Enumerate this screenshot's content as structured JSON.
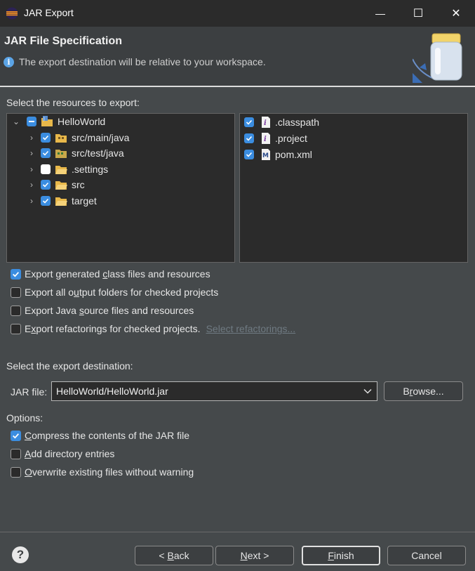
{
  "window": {
    "title": "JAR Export",
    "minimize_glyph": "—",
    "maximize_glyph": "☐",
    "close_glyph": "✕"
  },
  "header": {
    "title": "JAR File Specification",
    "message": "The export destination will be relative to your workspace.",
    "info_glyph": "i"
  },
  "resources": {
    "label": "Select the resources to export:",
    "tree": [
      {
        "label": "HelloWorld",
        "state": "mixed",
        "expanded": true,
        "icon": "project-icon"
      },
      {
        "label": "src/main/java",
        "state": "checked",
        "icon": "package-folder-icon"
      },
      {
        "label": "src/test/java",
        "state": "checked",
        "icon": "package-folder-icon"
      },
      {
        "label": ".settings",
        "state": "unchecked",
        "icon": "folder-icon"
      },
      {
        "label": "src",
        "state": "checked",
        "icon": "folder-icon"
      },
      {
        "label": "target",
        "state": "checked",
        "icon": "folder-icon"
      }
    ],
    "files": [
      {
        "label": ".classpath",
        "state": "checked",
        "icon": "file-icon"
      },
      {
        "label": ".project",
        "state": "checked",
        "icon": "file-icon"
      },
      {
        "label": "pom.xml",
        "state": "checked",
        "icon": "maven-file-icon"
      }
    ]
  },
  "export_options": {
    "class_files": {
      "pre": "Export generated ",
      "u": "c",
      "post": "lass files and resources",
      "checked": true
    },
    "output_folders": {
      "pre": "Export all o",
      "u": "u",
      "post": "tput folders for checked projects",
      "checked": false
    },
    "source_files": {
      "pre": "Export Java ",
      "u": "s",
      "post": "ource files and resources",
      "checked": false
    },
    "refactorings": {
      "pre": "E",
      "u": "x",
      "post": "port refactorings for checked projects.",
      "checked": false
    },
    "select_refactorings_link": "Select refactorings..."
  },
  "destination": {
    "label": "Select the export destination:",
    "jar_label": "JAR file:",
    "jar_value": "HelloWorld/HelloWorld.jar",
    "browse": {
      "pre": "B",
      "u": "r",
      "post": "owse..."
    }
  },
  "options": {
    "label": "Options:",
    "compress": {
      "pre": "",
      "u": "C",
      "post": "ompress the contents of the JAR file",
      "checked": true
    },
    "directory": {
      "pre": "",
      "u": "A",
      "post": "dd directory entries",
      "checked": false
    },
    "overwrite": {
      "pre": "",
      "u": "O",
      "post": "verwrite existing files without warning",
      "checked": false
    }
  },
  "buttons": {
    "help": "?",
    "back": {
      "pre": "< ",
      "u": "B",
      "post": "ack"
    },
    "next": {
      "pre": "",
      "u": "N",
      "post": "ext >"
    },
    "finish": {
      "pre": "",
      "u": "F",
      "post": "inish"
    },
    "cancel": "Cancel"
  },
  "colors": {
    "accent": "#3b8de0",
    "background": "#45494b",
    "panel": "#2b2b2b"
  }
}
